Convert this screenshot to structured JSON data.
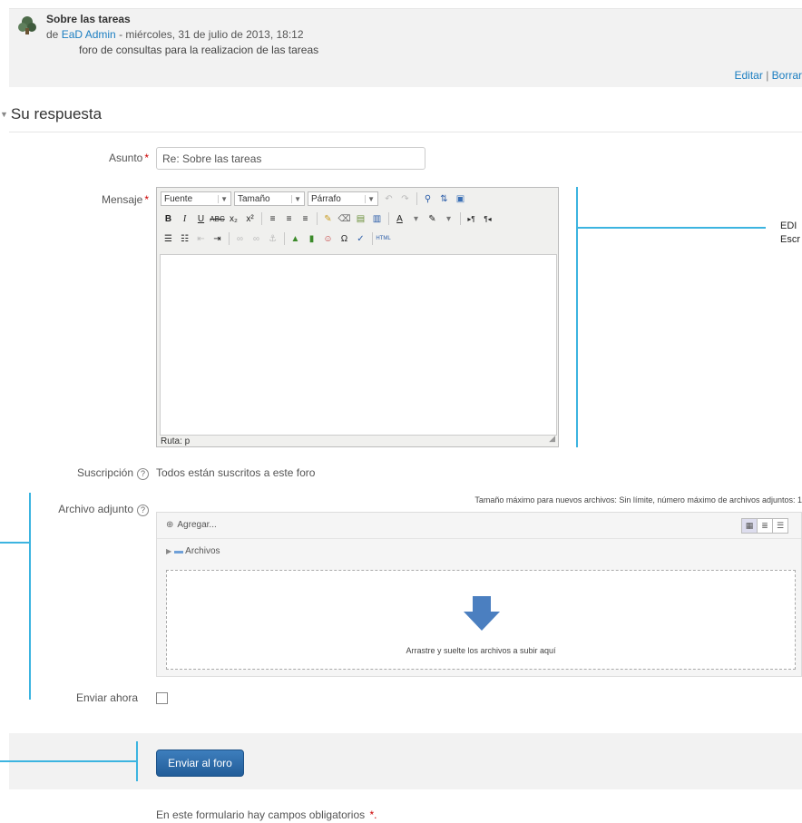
{
  "post": {
    "title": "Sobre las tareas",
    "by_prefix": "de",
    "author": "EaD Admin",
    "date": " - miércoles, 31 de julio de 2013, 18:12",
    "message": "foro de consultas para la realizacion de las tareas",
    "edit_label": "Editar",
    "separator": " | ",
    "delete_label": "Borrar"
  },
  "section": {
    "title": "Su respuesta"
  },
  "form": {
    "subject_label": "Asunto",
    "subject_value": "Re: Sobre las tareas",
    "message_label": "Mensaje",
    "required_mark": "*",
    "subscription_label": "Suscripción",
    "subscription_value": "Todos están suscritos a este foro",
    "attachment_label": "Archivo adjunto",
    "send_now_label": "Enviar ahora",
    "submit_label": "Enviar al foro",
    "footnote": "En este formulario hay campos obligatorios",
    "footnote_mark": "*."
  },
  "editor": {
    "font_select": "Fuente",
    "size_select": "Tamaño",
    "format_select": "Párrafo",
    "path_label": "Ruta: p"
  },
  "filepicker": {
    "info": "Tamaño máximo para nuevos archivos: Sin límite, número máximo de archivos adjuntos: 1",
    "add_label": "Agregar...",
    "folder_label": "Archivos",
    "drop_text": "Arrastre y suelte los archivos a subir aquí"
  },
  "annotation": {
    "line1": "EDI",
    "line2": "Escr"
  },
  "colors": {
    "link": "#1b7ec1",
    "annotation": "#3cb4e0",
    "button": "#2a69a8",
    "required": "#cc0000"
  }
}
